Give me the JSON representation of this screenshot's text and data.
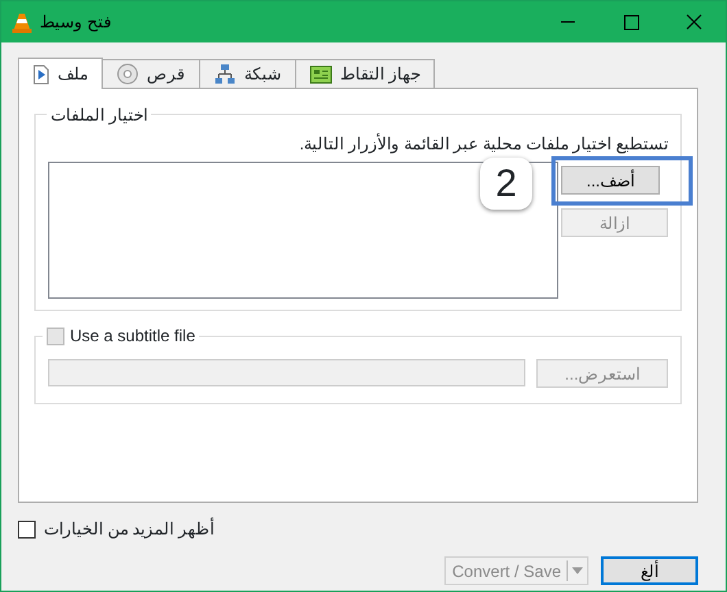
{
  "window": {
    "title": "فتح وسيط"
  },
  "tabs": [
    {
      "label": "جهاز التقاط",
      "selected": false
    },
    {
      "label": "شبكة",
      "selected": false
    },
    {
      "label": "قرص",
      "selected": false
    },
    {
      "label": "ملف",
      "selected": true
    }
  ],
  "file_selection": {
    "title": "اختيار الملفات",
    "instruction": "تستطيع اختيار ملفات محلية عبر القائمة والأزرار التالية.",
    "buttons": [
      {
        "label": "أضف...",
        "disabled": false
      },
      {
        "label": "ازالة",
        "disabled": true
      }
    ]
  },
  "annotation": {
    "number": "2"
  },
  "subtitle": {
    "label": "Use a subtitle file",
    "checked": false,
    "browse_button": {
      "label": "استعرض...",
      "disabled": true
    }
  },
  "more_options": {
    "label": "أظهر المزيد من الخيارات",
    "checked": false
  },
  "footer_buttons": [
    {
      "label": "ألغ",
      "kind": "plain",
      "disabled": false,
      "focused": true
    },
    {
      "label": "Convert / Save",
      "kind": "split",
      "disabled": true,
      "focused": false
    }
  ]
}
